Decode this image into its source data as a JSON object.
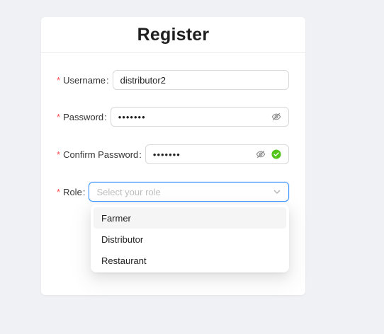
{
  "form": {
    "title": "Register",
    "required_marker": "*",
    "colon": ":",
    "username": {
      "label": "Username",
      "value": "distributor2"
    },
    "password": {
      "label": "Password",
      "value": "•••••••"
    },
    "confirm_password": {
      "label": "Confirm Password",
      "value": "•••••••",
      "status": "valid"
    },
    "role": {
      "label": "Role",
      "placeholder": "Select your role",
      "options": [
        {
          "label": "Farmer",
          "highlighted": true
        },
        {
          "label": "Distributor",
          "highlighted": false
        },
        {
          "label": "Restaurant",
          "highlighted": false
        }
      ]
    }
  },
  "colors": {
    "required": "#ff4d4f",
    "focus_border": "#4096ff",
    "success": "#52c41a",
    "page_background": "#f0f1f5"
  },
  "icons": {
    "password_toggle": "eye-invisible-icon",
    "valid": "check-circle-icon",
    "select_arrow": "chevron-down-icon"
  }
}
